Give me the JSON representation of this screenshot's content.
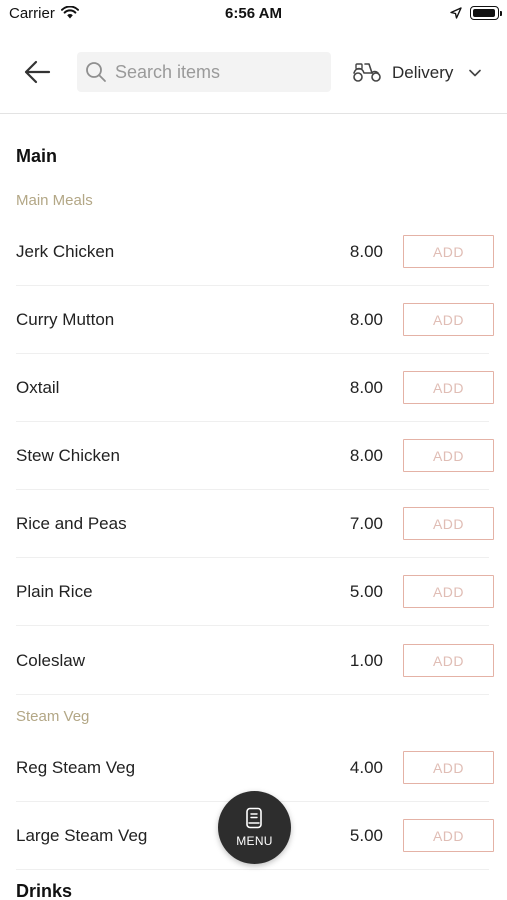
{
  "status_bar": {
    "carrier": "Carrier",
    "time": "6:56 AM"
  },
  "header": {
    "search_placeholder": "Search items",
    "delivery_label": "Delivery"
  },
  "menu": {
    "section_main": "Main",
    "categories": {
      "main_meals": {
        "title": "Main Meals",
        "items": [
          {
            "name": "Jerk Chicken",
            "price": "8.00",
            "add": "ADD"
          },
          {
            "name": "Curry Mutton",
            "price": "8.00",
            "add": "ADD"
          },
          {
            "name": "Oxtail",
            "price": "8.00",
            "add": "ADD"
          },
          {
            "name": "Stew Chicken",
            "price": "8.00",
            "add": "ADD"
          },
          {
            "name": "Rice and Peas",
            "price": "7.00",
            "add": "ADD"
          },
          {
            "name": "Plain Rice",
            "price": "5.00",
            "add": "ADD"
          },
          {
            "name": "Coleslaw",
            "price": "1.00",
            "add": "ADD"
          }
        ]
      },
      "steam_veg": {
        "title": "Steam Veg",
        "items": [
          {
            "name": "Reg Steam Veg",
            "price": "4.00",
            "add": "ADD"
          },
          {
            "name": "Large Steam Veg",
            "price": "5.00",
            "add": "ADD"
          }
        ]
      }
    },
    "section_drinks": "Drinks"
  },
  "fab": {
    "label": "MENU"
  },
  "colors": {
    "accent_border": "#e4b2a6",
    "category_text": "#b3a786",
    "fab_bg": "#2d2d2d"
  }
}
